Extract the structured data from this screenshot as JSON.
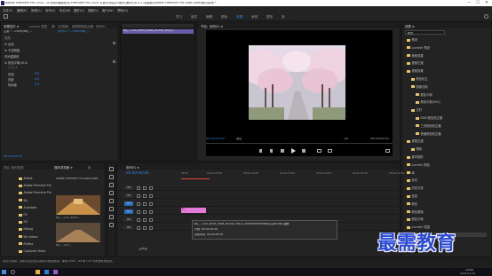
{
  "window": {
    "title": "Adobe Premiere Pro 2020 - D:\\例析\\最新精讲 Premiere Pro 2020 从新手到高手\\素材\\第8章\\8.3.2 改善素材\\dobe Premiere Pro Auto-Save\\素材剪辑 *",
    "controls": [
      "—",
      "☐",
      "✕"
    ]
  },
  "menu": [
    "文件(F)",
    "编辑(E)",
    "剪辑(C)",
    "序列(S)",
    "标记(M)",
    "图形(G)",
    "视图(V)",
    "窗口(W)",
    "帮助(H)"
  ],
  "workspaces": [
    "学习",
    "组件",
    "编辑",
    "颜色",
    "效果",
    "音频",
    "图形",
    "库"
  ],
  "workspace_active": "效果",
  "effects_panel": {
    "tabs": [
      "效果控件 ≡",
      "Lumetri 范围",
      "源：(无剪辑)",
      "音频剪辑混合器：序列01"
    ],
    "master_label": "主要 * ...com/i/ttq_...",
    "sequence_label": "序列01 * ...com/i/ttq_...",
    "rows": [
      {
        "label": "视频",
        "value": ""
      },
      {
        "label": "fx 运动",
        "value": ""
      },
      {
        "label": "fx 不透明度",
        "value": ""
      },
      {
        "label": "时间重映射",
        "value": ""
      },
      {
        "label": "fx 颜色平衡(HLS)",
        "value": ""
      },
      {
        "label": "○ □ ♪",
        "value": ""
      },
      {
        "label": "色相",
        "value": "0.0"
      },
      {
        "label": "亮度",
        "value": "0.0"
      },
      {
        "label": "饱和度",
        "value": "0.0"
      }
    ],
    "timecode": "00:00:00:00",
    "clip_name": "ttq_...com_2015_2016_thumb_700_0..."
  },
  "program_monitor": {
    "tab": "节目：序列01 ≡",
    "timecode_left": "00:00:00:00",
    "fit": "适合",
    "fraction": "1/4",
    "timecode_right": "00:00:05:00"
  },
  "effects_browser": {
    "search_placeholder": "颜色",
    "tree": [
      {
        "label": "预设",
        "depth": 0
      },
      {
        "label": "Lumetri 预设",
        "depth": 0
      },
      {
        "label": "音频效果",
        "depth": 0
      },
      {
        "label": "音频过渡",
        "depth": 0
      },
      {
        "label": "视频效果",
        "depth": 0
      },
      {
        "label": "颜色校正",
        "depth": 1
      },
      {
        "label": "图像控制",
        "depth": 1
      },
      {
        "label": "颜色平衡",
        "depth": 2
      },
      {
        "label": "颜色平衡(HLS)",
        "depth": 2
      },
      {
        "label": "过时",
        "depth": 1
      },
      {
        "label": "RGB 颜色校正器",
        "depth": 2
      },
      {
        "label": "三向颜色校正器",
        "depth": 2
      },
      {
        "label": "快速颜色校正器",
        "depth": 2
      },
      {
        "label": "视频过渡",
        "depth": 0
      },
      {
        "label": "擦除",
        "depth": 1
      },
      {
        "label": "基本图形",
        "depth": 0
      },
      {
        "label": "Lumetri 颜色",
        "depth": 0
      },
      {
        "label": "库",
        "depth": 0
      },
      {
        "label": "标记",
        "depth": 0
      },
      {
        "label": "历史记录",
        "depth": 0
      },
      {
        "label": "信息",
        "depth": 0
      },
      {
        "label": "颜色",
        "depth": 0
      },
      {
        "label": "颜色替换",
        "depth": 0
      },
      {
        "label": "颜色平衡",
        "depth": 0
      },
      {
        "label": "Lumetri 范围",
        "depth": 0
      },
      {
        "label": "效果控件",
        "depth": 0
      },
      {
        "label": "基本声音",
        "depth": 0
      }
    ],
    "selected": "效果控件"
  },
  "project_panel": {
    "tabs": [
      "项目: 素材剪辑",
      "媒体浏览器 ≡",
      "库"
    ],
    "folders": [
      "Adobe",
      "Adobe Premiere Pro",
      "Adobe Premiere Pro Auto-Save",
      "My",
      "Autodesk",
      "FX",
      "SD",
      "Debug",
      "My videos",
      "ProRes",
      "Captured Video"
    ],
    "thumb_title": "Adobe Premiere Pro Auto-Save",
    "thumb_label": "ttq_...com_2015...",
    "thumb_label2": "ttq_...com_..."
  },
  "timeline": {
    "tab": "序列01 ≡",
    "timecode": "00:00:00:00",
    "ruler": [
      "00:00",
      "00:00:05:00",
      "00:00:10:00",
      "00:00:15:00",
      "00:00:20:00",
      "00:00:25:00",
      "00:00:30:00"
    ],
    "tracks": [
      "V3",
      "V2",
      "V1",
      "A1",
      "A2",
      "A3"
    ],
    "clip_label": "fx",
    "tooltip_line1": "ttq_...com_2015_2016_thumb_700_0_20150329155626.jpg\\Profile 图像",
    "tooltip_line2": "开始: 00:00:00:00",
    "tooltip_line3": "持续时间: 00:00:05:00",
    "master": "主声道"
  },
  "status": {
    "text": "单击以选择，或单击空白处并拖动以框选选择。使用 Shift、Alt 和 Ctrl 可获得其他选项。",
    "clock": "15:00",
    "date": "2021/11/12"
  },
  "watermark": "最需教育",
  "colors": {
    "accent": "#2d8ceb",
    "panel": "#232323",
    "clip_pink": "#e37ad8",
    "playhead": "#2d8ceb"
  }
}
